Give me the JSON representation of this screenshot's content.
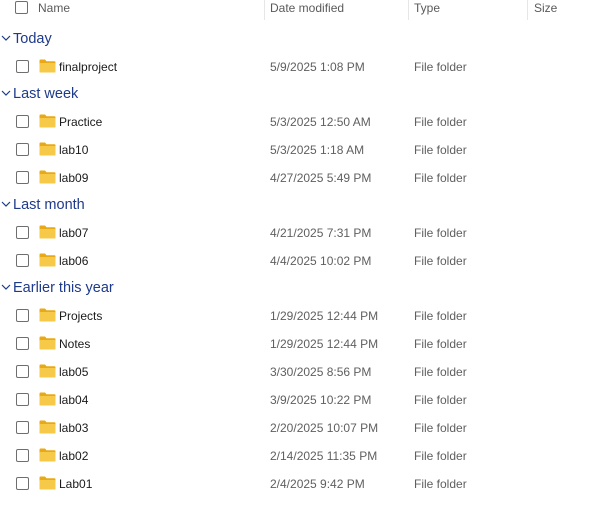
{
  "columns": {
    "name": "Name",
    "date_modified": "Date modified",
    "type": "Type",
    "size": "Size"
  },
  "icons": {
    "folder": "folder-icon",
    "chevron": "chevron-down-icon"
  },
  "colors": {
    "group_title": "#1e3a8a",
    "folder_body": "#f7c948",
    "folder_back": "#e8a917"
  },
  "groups": [
    {
      "title": "Today",
      "items": [
        {
          "name": "finalproject",
          "date": "5/9/2025 1:08 PM",
          "type": "File folder"
        }
      ]
    },
    {
      "title": "Last week",
      "items": [
        {
          "name": "Practice",
          "date": "5/3/2025 12:50 AM",
          "type": "File folder"
        },
        {
          "name": "lab10",
          "date": "5/3/2025 1:18 AM",
          "type": "File folder"
        },
        {
          "name": "lab09",
          "date": "4/27/2025 5:49 PM",
          "type": "File folder"
        }
      ]
    },
    {
      "title": "Last month",
      "items": [
        {
          "name": "lab07",
          "date": "4/21/2025 7:31 PM",
          "type": "File folder"
        },
        {
          "name": "lab06",
          "date": "4/4/2025 10:02 PM",
          "type": "File folder"
        }
      ]
    },
    {
      "title": "Earlier this year",
      "items": [
        {
          "name": "Projects",
          "date": "1/29/2025 12:44 PM",
          "type": "File folder"
        },
        {
          "name": "Notes",
          "date": "1/29/2025 12:44 PM",
          "type": "File folder"
        },
        {
          "name": "lab05",
          "date": "3/30/2025 8:56 PM",
          "type": "File folder"
        },
        {
          "name": "lab04",
          "date": "3/9/2025 10:22 PM",
          "type": "File folder"
        },
        {
          "name": "lab03",
          "date": "2/20/2025 10:07 PM",
          "type": "File folder"
        },
        {
          "name": "lab02",
          "date": "2/14/2025 11:35 PM",
          "type": "File folder"
        },
        {
          "name": "Lab01",
          "date": "2/4/2025 9:42 PM",
          "type": "File folder"
        }
      ]
    }
  ]
}
